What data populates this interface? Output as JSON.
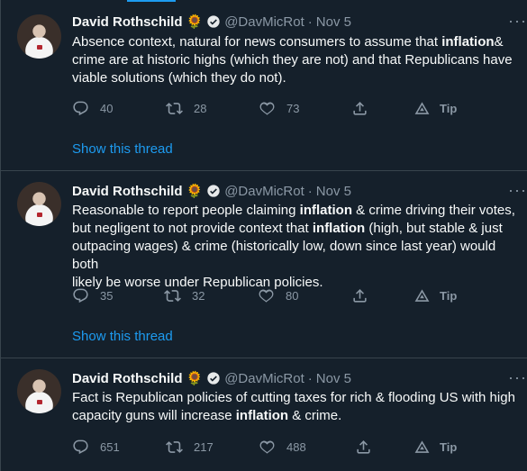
{
  "tweets": [
    {
      "author": "David Rothschild",
      "emoji": "🌻",
      "handle": "@DavMicRot",
      "dot": "·",
      "date": "Nov 5",
      "lines": [
        [
          "Absence context, natural for news consumers to assume that ",
          "inflation",
          "&"
        ],
        [
          "crime are at historic highs (which they are not) and that Republicans have"
        ],
        [
          "viable solutions (which they do not)."
        ]
      ],
      "reply_count": "40",
      "retweet_count": "28",
      "like_count": "73",
      "tip_label": "Tip",
      "show_thread": "Show this thread"
    },
    {
      "author": "David Rothschild",
      "emoji": "🌻",
      "handle": "@DavMicRot",
      "dot": "·",
      "date": "Nov 5",
      "lines": [
        [
          "Reasonable to report people claiming ",
          "inflation",
          " & crime driving their votes,"
        ],
        [
          "but negligent to not provide context that ",
          "inflation",
          " (high, but stable & just"
        ],
        [
          "outpacing wages) & crime (historically low, down since last year) would both"
        ],
        [
          "likely be worse under Republican policies."
        ]
      ],
      "reply_count": "35",
      "retweet_count": "32",
      "like_count": "80",
      "tip_label": "Tip",
      "show_thread": "Show this thread"
    },
    {
      "author": "David Rothschild",
      "emoji": "🌻",
      "handle": "@DavMicRot",
      "dot": "·",
      "date": "Nov 5",
      "lines": [
        [
          "Fact is Republican policies of cutting taxes for rich & flooding US with high"
        ],
        [
          "capacity guns will increase ",
          "inflation",
          " & crime."
        ]
      ],
      "reply_count": "651",
      "retweet_count": "217",
      "like_count": "488",
      "tip_label": "Tip"
    }
  ],
  "colors": {
    "background": "#15202b",
    "text": "#f7f9f9",
    "muted": "#8b98a5",
    "accent": "#1d9bf0",
    "border": "#38444d"
  },
  "icons": [
    "reply-icon",
    "retweet-icon",
    "like-icon",
    "share-icon",
    "tip-icon",
    "verified-badge-icon",
    "more-icon"
  ]
}
